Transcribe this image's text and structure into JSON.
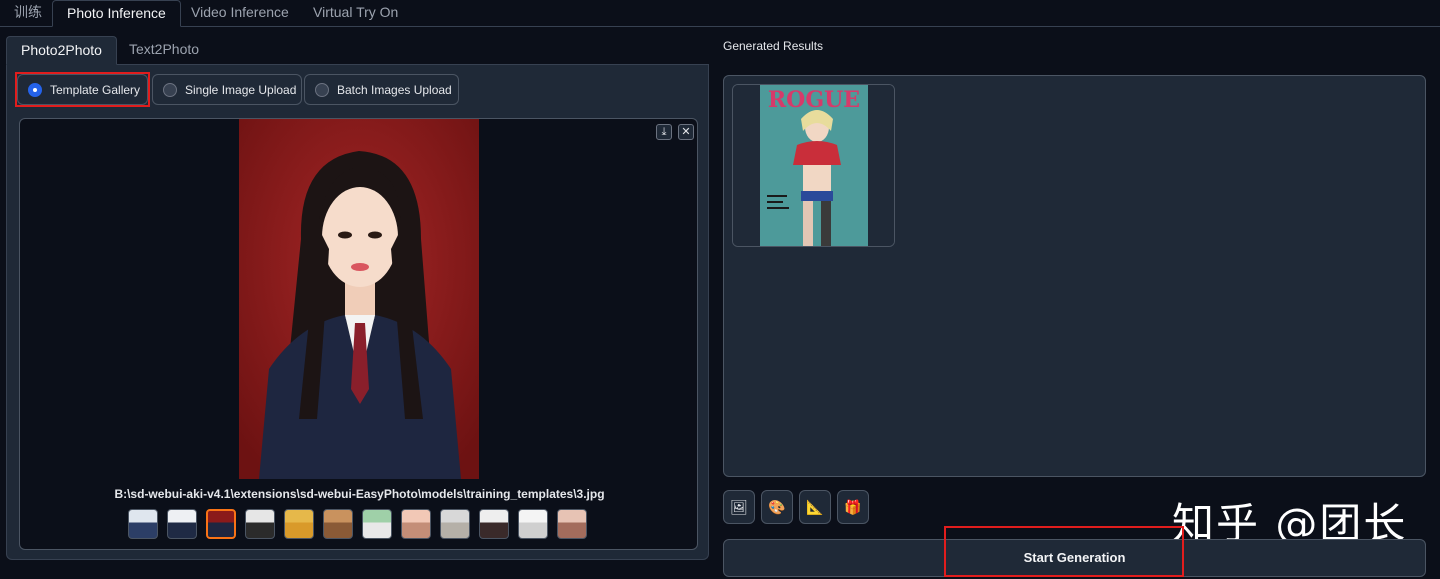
{
  "top_tabs": [
    "训练",
    "Photo Inference",
    "Video Inference",
    "Virtual Try On"
  ],
  "sub_tabs": [
    "Photo2Photo",
    "Text2Photo"
  ],
  "radio_options": [
    "Template Gallery",
    "Single Image Upload",
    "Batch Images Upload"
  ],
  "selected_radio": "Template Gallery",
  "gallery": {
    "download_icon": "⤓",
    "close_icon": "✕",
    "caption": "B:\\sd-webui-aki-v4.1\\extensions\\sd-webui-EasyPhoto\\models\\training_templates\\3.jpg",
    "thumbnail_count": 12,
    "selected_index": 2
  },
  "results": {
    "label": "Generated Results",
    "magazine_title": "ROGUE"
  },
  "toolbar_icons": [
    "image-icon",
    "palette-icon",
    "triangle-ruler-icon",
    "gift-icon"
  ],
  "start_button": "Start Generation",
  "watermark": "知乎 @团长",
  "colors": {
    "accent": "#2563eb",
    "highlight_box": "#e11d1d",
    "selected_thumb": "#f97316"
  }
}
